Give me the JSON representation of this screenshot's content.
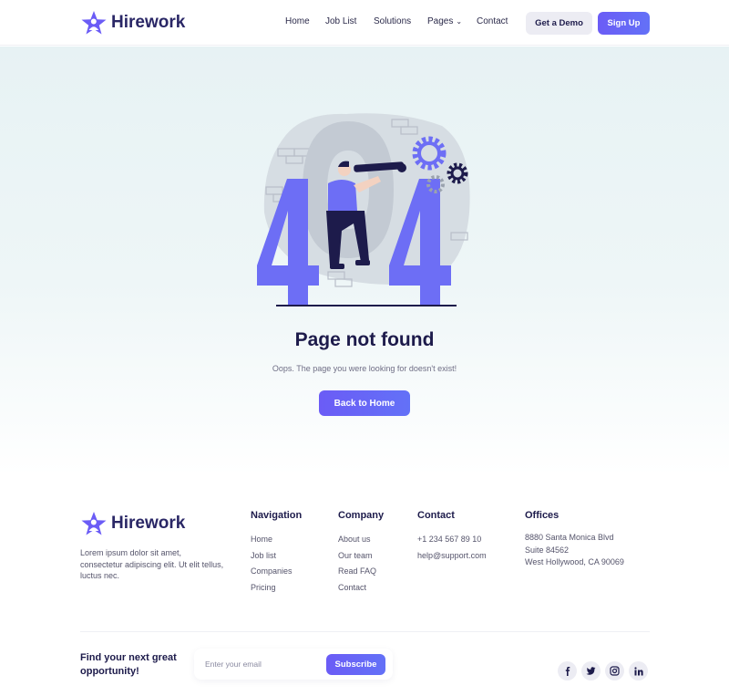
{
  "brand": {
    "name": "Hirework",
    "accent": "#6b5cf6",
    "dark": "#1d1b4b"
  },
  "header": {
    "nav": [
      {
        "label": "Home"
      },
      {
        "label": "Job List"
      },
      {
        "label": "Solutions"
      },
      {
        "label": "Pages"
      },
      {
        "label": "Contact"
      }
    ],
    "demo_label": "Get a Demo",
    "signup_label": "Sign Up"
  },
  "hero": {
    "title": "Page not found",
    "subtitle": "Oops. The page you were looking for doesn't exist!",
    "button_label": "Back to Home"
  },
  "footer": {
    "about": "Lorem ipsum dolor sit amet, consectetur adipiscing elit. Ut elit tellus, luctus nec.",
    "navigation": {
      "heading": "Navigation",
      "links": [
        "Home",
        "Job list",
        "Companies",
        "Pricing"
      ]
    },
    "company": {
      "heading": "Company",
      "links": [
        "About us",
        "Our team",
        "Read FAQ",
        "Contact"
      ]
    },
    "contact": {
      "heading": "Contact",
      "lines": [
        "+1 234 567 89 10",
        "help@support.com"
      ]
    },
    "offices": {
      "heading": "Offices",
      "lines": [
        "8880 Santa Monica Blvd",
        "Suite 84562",
        "West Hollywood, CA 90069"
      ]
    },
    "cta": "Find your next great opportunity!",
    "newsletter": {
      "placeholder": "Enter your email",
      "button_label": "Subscribe"
    },
    "social": [
      "facebook-icon",
      "twitter-icon",
      "instagram-icon",
      "linkedin-icon"
    ]
  }
}
